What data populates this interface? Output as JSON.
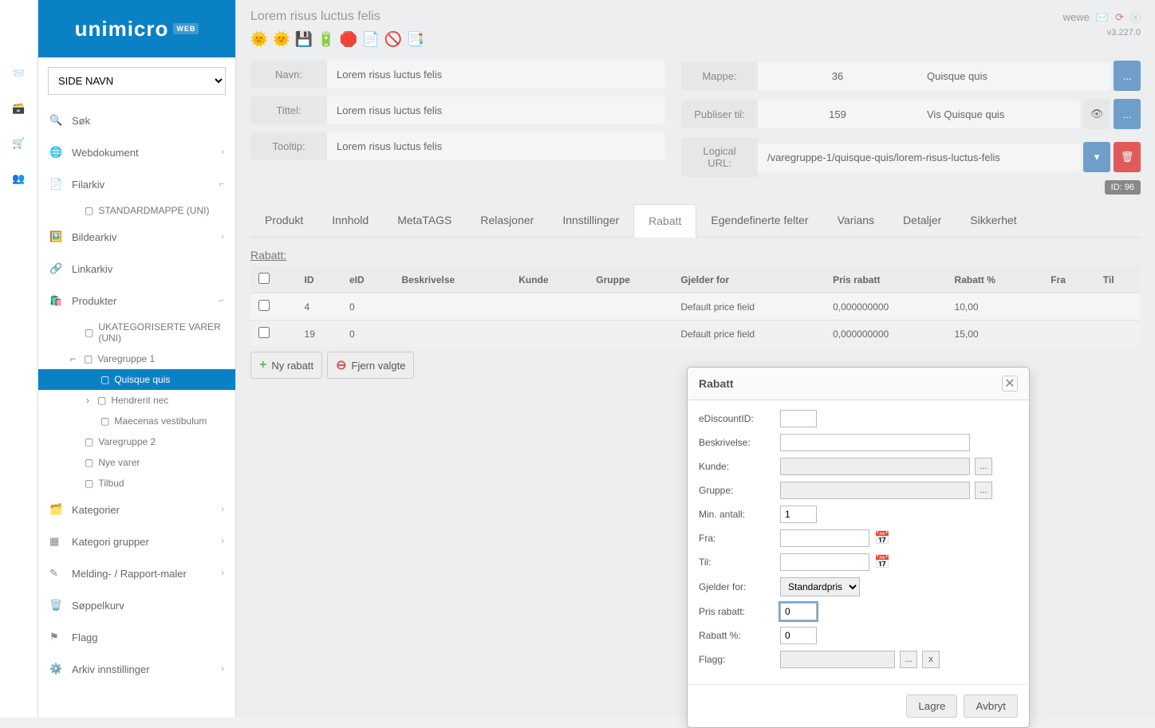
{
  "brand": {
    "name": "unimicro",
    "suffix": "WEB"
  },
  "user": {
    "name": "wewe",
    "version": "v3.227.0"
  },
  "page_select": "SIDE NAVN",
  "sidebar": {
    "search_label": "Søk",
    "items": [
      {
        "label": "Webdokument",
        "chev": "›"
      },
      {
        "label": "Filarkiv",
        "chev": "⌐"
      },
      {
        "label": "Bildearkiv",
        "chev": "›"
      },
      {
        "label": "Linkarkiv",
        "chev": ""
      },
      {
        "label": "Produkter",
        "chev": "⌐"
      },
      {
        "label": "Kategorier",
        "chev": "›"
      },
      {
        "label": "Kategori grupper",
        "chev": "›"
      },
      {
        "label": "Melding- / Rapport-maler",
        "chev": "›"
      },
      {
        "label": "Søppelkurv",
        "chev": ""
      },
      {
        "label": "Flagg",
        "chev": ""
      },
      {
        "label": "Arkiv innstillinger",
        "chev": "›"
      }
    ],
    "filarkiv_sub": "STANDARDMAPPE (UNI)",
    "produkter_sub": [
      "UKATEGORISERTE VARER (UNI)",
      "Varegruppe 1",
      "Quisque quis",
      "Hendrerit nec",
      "Maecenas vestibulum",
      "Varegruppe 2",
      "Nye varer",
      "Tilbud"
    ]
  },
  "page_title": "Lorem risus luctus felis",
  "form": {
    "navn_label": "Navn:",
    "navn_value": "Lorem risus luctus felis",
    "tittel_label": "Tittel:",
    "tittel_value": "Lorem risus luctus felis",
    "tooltip_label": "Tooltip:",
    "tooltip_value": "Lorem risus luctus felis",
    "mappe_label": "Mappe:",
    "mappe_num": "36",
    "mappe_value": "Quisque quis",
    "publiser_label": "Publiser til:",
    "publiser_num": "159",
    "publiser_value": "Vis Quisque quis",
    "url_label": "Logical URL:",
    "url_value": "/varegruppe-1/quisque-quis/lorem-risus-luctus-felis",
    "id_badge": "ID: 96",
    "ellipsis": "..."
  },
  "tabs": [
    "Produkt",
    "Innhold",
    "MetaTAGS",
    "Relasjoner",
    "Innstillinger",
    "Rabatt",
    "Egendefinerte felter",
    "Varians",
    "Detaljer",
    "Sikkerhet"
  ],
  "active_tab": 5,
  "rabatt": {
    "section_title": "Rabatt:",
    "headers": [
      "",
      "ID",
      "eID",
      "Beskrivelse",
      "Kunde",
      "Gruppe",
      "Gjelder for",
      "Pris rabatt",
      "Rabatt %",
      "Fra",
      "Til"
    ],
    "rows": [
      {
        "id": "4",
        "eid": "0",
        "beskrivelse": "",
        "kunde": "",
        "gruppe": "",
        "gjelder": "Default price field",
        "pris": "0,000000000",
        "pct": "10,00",
        "fra": "",
        "til": ""
      },
      {
        "id": "19",
        "eid": "0",
        "beskrivelse": "",
        "kunde": "",
        "gruppe": "",
        "gjelder": "Default price field",
        "pris": "0,000000000",
        "pct": "15,00",
        "fra": "",
        "til": ""
      }
    ],
    "btn_new": "Ny rabatt",
    "btn_remove": "Fjern valgte"
  },
  "dialog": {
    "title": "Rabatt",
    "fields": {
      "eDiscountID": "eDiscountID:",
      "beskrivelse": "Beskrivelse:",
      "kunde": "Kunde:",
      "gruppe": "Gruppe:",
      "min_antall": "Min. antall:",
      "min_antall_val": "1",
      "fra": "Fra:",
      "til": "Til:",
      "gjelder": "Gjelder for:",
      "gjelder_val": "Standardpris",
      "pris_rabatt": "Pris rabatt:",
      "pris_rabatt_val": "0",
      "rabatt_pct": "Rabatt %:",
      "rabatt_pct_val": "0",
      "flagg": "Flagg:"
    },
    "picker": "...",
    "clear": "x",
    "save": "Lagre",
    "cancel": "Avbryt"
  }
}
